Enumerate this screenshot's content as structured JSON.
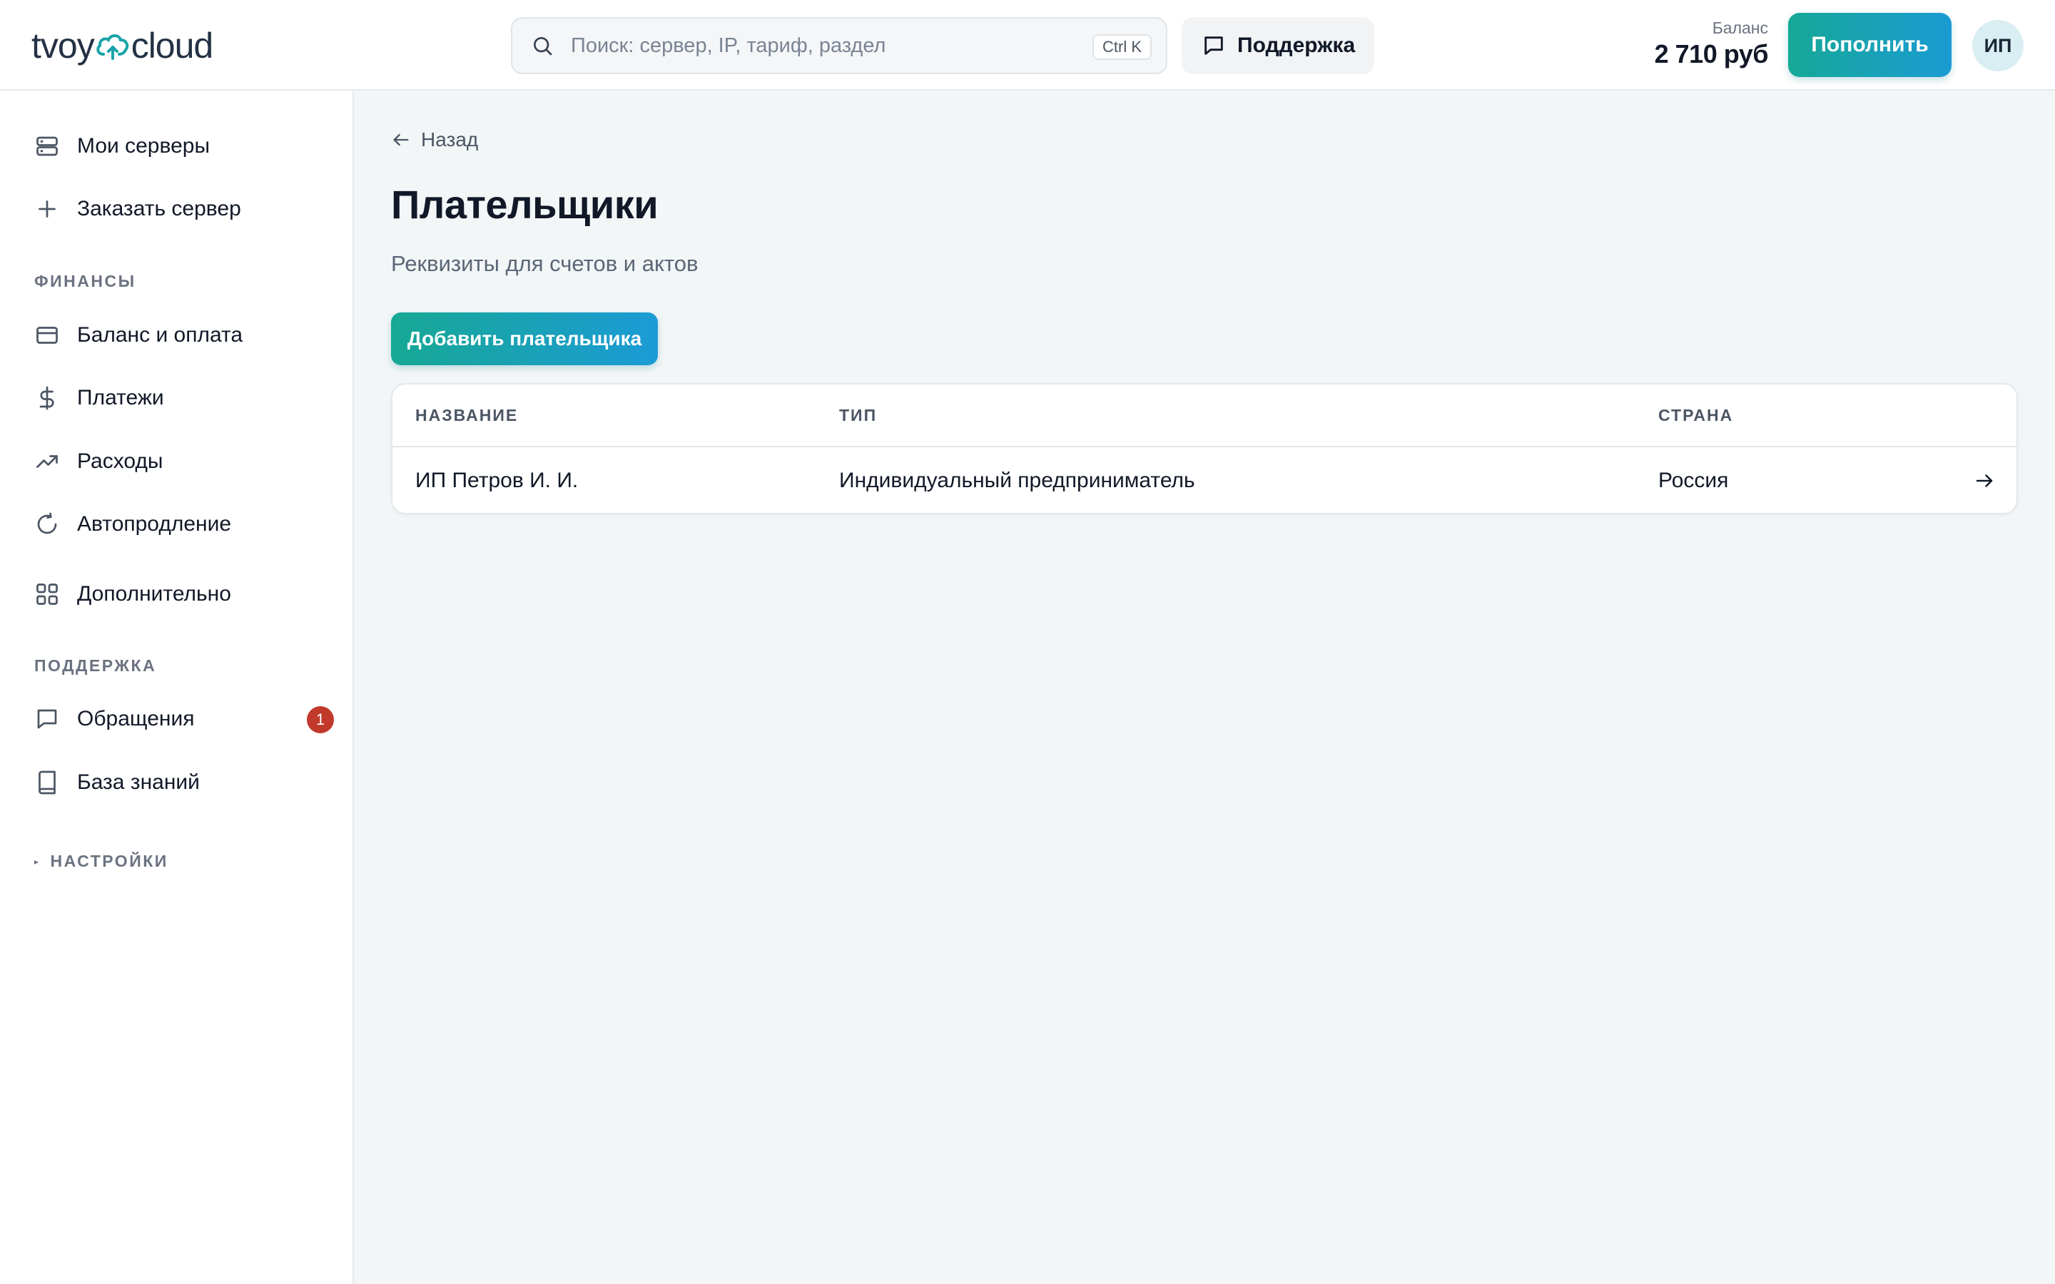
{
  "header": {
    "logo": {
      "part1": "tvoy",
      "part2": "cloud"
    },
    "search": {
      "placeholder": "Поиск: сервер, IP, тариф, раздел",
      "shortcut": "Ctrl K"
    },
    "support_label": "Поддержка",
    "balance": {
      "label": "Баланс",
      "value": "2 710 руб"
    },
    "topup_label": "Пополнить",
    "avatar_initials": "ИП"
  },
  "sidebar": {
    "items": [
      {
        "label": "Мои серверы",
        "icon": "server-icon"
      },
      {
        "label": "Заказать сервер",
        "icon": "plus-icon"
      }
    ],
    "finance": {
      "title": "ФИНАНСЫ",
      "items": [
        {
          "label": "Баланс и оплата",
          "icon": "credit-card-icon"
        },
        {
          "label": "Платежи",
          "icon": "dollar-icon"
        },
        {
          "label": "Расходы",
          "icon": "trending-up-icon"
        },
        {
          "label": "Автопродление",
          "icon": "refresh-icon"
        },
        {
          "label": "Дополнительно",
          "icon": "grid-icon"
        }
      ]
    },
    "support": {
      "title": "ПОДДЕРЖКА",
      "items": [
        {
          "label": "Обращения",
          "icon": "message-icon",
          "badge": "1"
        },
        {
          "label": "База знаний",
          "icon": "book-icon"
        }
      ]
    },
    "settings": {
      "title": "НАСТРОЙКИ",
      "collapsed": true
    }
  },
  "main": {
    "back_label": "Назад",
    "title": "Плательщики",
    "subtitle": "Реквизиты для счетов и актов",
    "add_button": "Добавить плательщика",
    "table": {
      "columns": [
        "НАЗВАНИЕ",
        "ТИП",
        "СТРАНА"
      ],
      "rows": [
        {
          "name": "ИП Петров И. И.",
          "type": "Индивидуальный предприниматель",
          "country": "Россия"
        }
      ]
    }
  },
  "colors": {
    "accent_start": "#16a897",
    "accent_end": "#1a9bd3",
    "badge": "#c0392b",
    "background": "#f3f6f7"
  }
}
